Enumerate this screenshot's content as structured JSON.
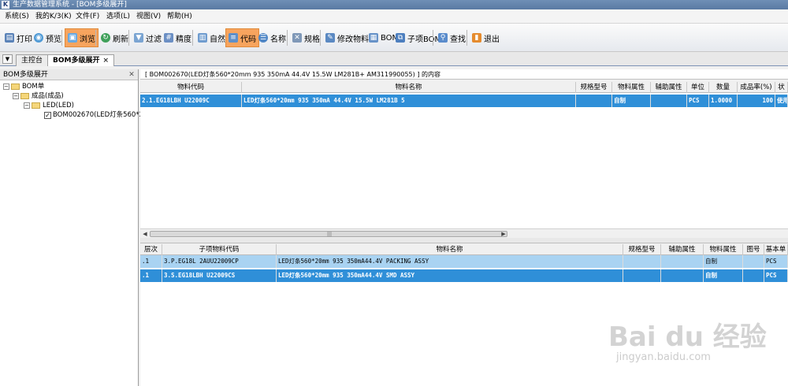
{
  "window": {
    "title": "生产数据管理系统 - [BOM多级展开]",
    "icon_letter": "K"
  },
  "menu": [
    "系统(S)",
    "我的K/3(K)",
    "文件(F)",
    "选项(L)",
    "视图(V)",
    "帮助(H)"
  ],
  "toolbar": {
    "print": "打印",
    "preview": "预览",
    "browse": "浏览",
    "refresh": "刷新",
    "filter": "过滤",
    "precision": "精度",
    "natural": "自然",
    "code": "代码",
    "name": "名称",
    "spec": "规格",
    "edit_material": "修改物料",
    "bom": "BOM",
    "sub_bom": "子项BOM",
    "find": "查找",
    "exit": "退出"
  },
  "tabs": {
    "console": "主控台",
    "bom_expand": "BOM多级展开"
  },
  "left_panel": {
    "title": "BOM多级展开",
    "tree": {
      "root": "BOM单",
      "level1": "成品(成品)",
      "level2": "LED(LED)",
      "level3": "BOM002670(LED灯条560*20mm"
    }
  },
  "info_bar": "[ BOM002670(LED灯条560*20mm 935 350mA  44.4V  15.5W    LM281B+    AM311990055) ] 的内容",
  "upper_grid": {
    "columns": [
      "物料代码",
      "物料名称",
      "规格型号",
      "物料属性",
      "辅助属性",
      "单位",
      "数量",
      "成品率(%)",
      "状"
    ],
    "rows": [
      {
        "code": "2.1.EG18LBH        U22009C",
        "name": "LED灯条560*20mm 935 350mA  44.4V  15.5W    LM281B              5",
        "spec": "",
        "attr": "自制",
        "aux": "",
        "unit": "PCS",
        "qty": "1.0000",
        "yield": "100",
        "status": "使用"
      }
    ]
  },
  "lower_grid": {
    "columns": [
      "层次",
      "子项物料代码",
      "物料名称",
      "规格型号",
      "辅助属性",
      "物料属性",
      "图号",
      "基本单"
    ],
    "rows": [
      {
        "level": ".1",
        "code": "3.P.EG18L     2AUU22009CP",
        "name": "LED灯条560*20mm 935 350mA44.4V PACKING ASSY",
        "spec": "",
        "aux": "",
        "attr": "自制",
        "drawing": "",
        "unit": "PCS"
      },
      {
        "level": ".1",
        "code": "3.S.EG18LBH    U22009CS",
        "name": "LED灯条560*20mm 935 350mA44.4V SMD ASSY",
        "spec": "",
        "aux": "",
        "attr": "自制",
        "drawing": "",
        "unit": "PCS"
      }
    ]
  },
  "watermark": {
    "logo": "Bai du 经验",
    "url": "jingyan.baidu.com"
  }
}
